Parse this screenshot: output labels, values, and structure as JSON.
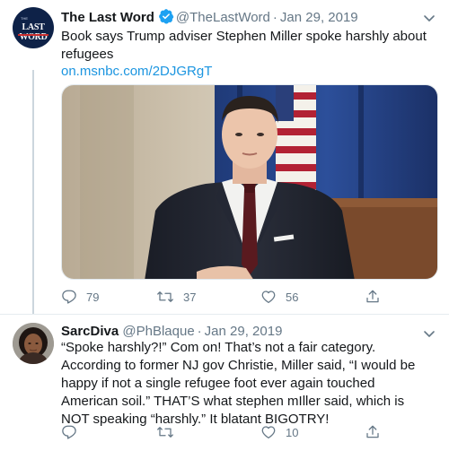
{
  "tweets": [
    {
      "author": {
        "name": "The Last Word",
        "handle": "@TheLastWord",
        "verified": true
      },
      "avatar_logo": {
        "small": "THE",
        "main": "LAST WORD"
      },
      "date": "Jan 29, 2019",
      "text": "Book says Trump adviser Stephen Miller spoke harshly about refugees",
      "link": "on.msnbc.com/2DJGRgT",
      "actions": {
        "replies": "79",
        "retweets": "37",
        "likes": "56"
      }
    },
    {
      "author": {
        "name": "SarcDiva",
        "handle": "@PhBlaque",
        "verified": false
      },
      "date": "Jan 29, 2019",
      "text": "“Spoke harshly?!” Com on! That’s not a fair category. According to former NJ gov Christie, Miller said, “I would be happy if not a single refugee foot ever again touched American soil.” THAT’S what stephen mIller said, which is NOT speaking “harshly.” It blatant BIGOTRY!",
      "actions": {
        "replies": "",
        "retweets": "",
        "likes": "10"
      }
    }
  ],
  "separator": "·",
  "colors": {
    "accent": "#1b95e0",
    "muted": "#657786",
    "text": "#14171a",
    "logo_bg": "#0e2248"
  },
  "icons": [
    "verified-badge-icon",
    "chevron-down-icon",
    "reply-icon",
    "retweet-icon",
    "like-icon",
    "share-icon"
  ]
}
